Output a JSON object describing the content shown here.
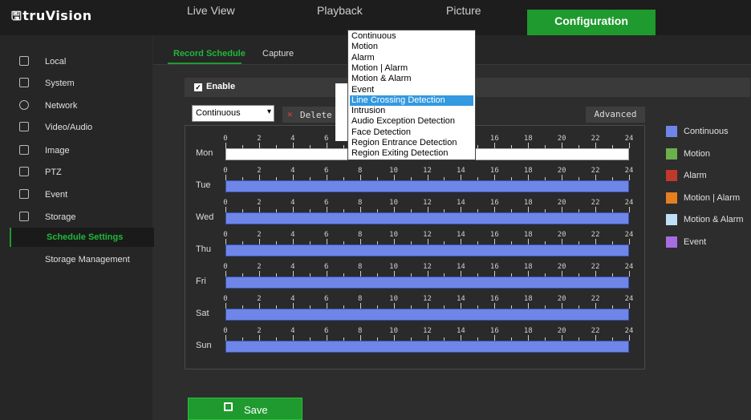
{
  "app": {
    "logo_mark": "🖫",
    "logo_text": "truVision"
  },
  "top_nav": [
    "Live View",
    "Playback",
    "Picture",
    "Configuration"
  ],
  "sidebar": {
    "items": [
      {
        "label": "Local",
        "icon": "monitor-icon"
      },
      {
        "label": "System",
        "icon": "system-icon"
      },
      {
        "label": "Network",
        "icon": "globe-icon"
      },
      {
        "label": "Video/Audio",
        "icon": "microphone-icon"
      },
      {
        "label": "Image",
        "icon": "image-icon"
      },
      {
        "label": "PTZ",
        "icon": "ptz-icon"
      },
      {
        "label": "Event",
        "icon": "event-icon"
      },
      {
        "label": "Storage",
        "icon": "storage-icon"
      }
    ],
    "sub_items": [
      "Schedule Settings",
      "Storage Management"
    ]
  },
  "subtabs": [
    "Record Schedule",
    "Capture"
  ],
  "enable": {
    "label": "Enable",
    "checked": true
  },
  "record_type_select": {
    "value": "Continuous",
    "arrow": "▾"
  },
  "delete_label": "Delete",
  "delete_icon": "✕",
  "advanced_label": "Advanced",
  "hours": [
    "0",
    "2",
    "4",
    "6",
    "8",
    "10",
    "12",
    "14",
    "16",
    "18",
    "20",
    "22",
    "24"
  ],
  "days": [
    "Mon",
    "Tue",
    "Wed",
    "Thu",
    "Fri",
    "Sat",
    "Sun"
  ],
  "legend": [
    {
      "label": "Continuous",
      "color": "#6d86e8"
    },
    {
      "label": "Motion",
      "color": "#6ab04c"
    },
    {
      "label": "Alarm",
      "color": "#c0392b"
    },
    {
      "label": "Motion | Alarm",
      "color": "#e67e22"
    },
    {
      "label": "Motion & Alarm",
      "color": "#bde0f5"
    },
    {
      "label": "Event",
      "color": "#a66ce0"
    }
  ],
  "dropdown": {
    "options": [
      "Continuous",
      "Motion",
      "Alarm",
      "Motion | Alarm",
      "Motion & Alarm",
      "Event",
      "Line Crossing Detection",
      "Intrusion",
      "Audio Exception Detection",
      "Face Detection",
      "Region Entrance Detection",
      "Region Exiting Detection"
    ],
    "highlighted": "Line Crossing Detection"
  },
  "save_label": "Save",
  "colors": {
    "accent": "#1f9a2e",
    "highlight": "#3399e0"
  }
}
